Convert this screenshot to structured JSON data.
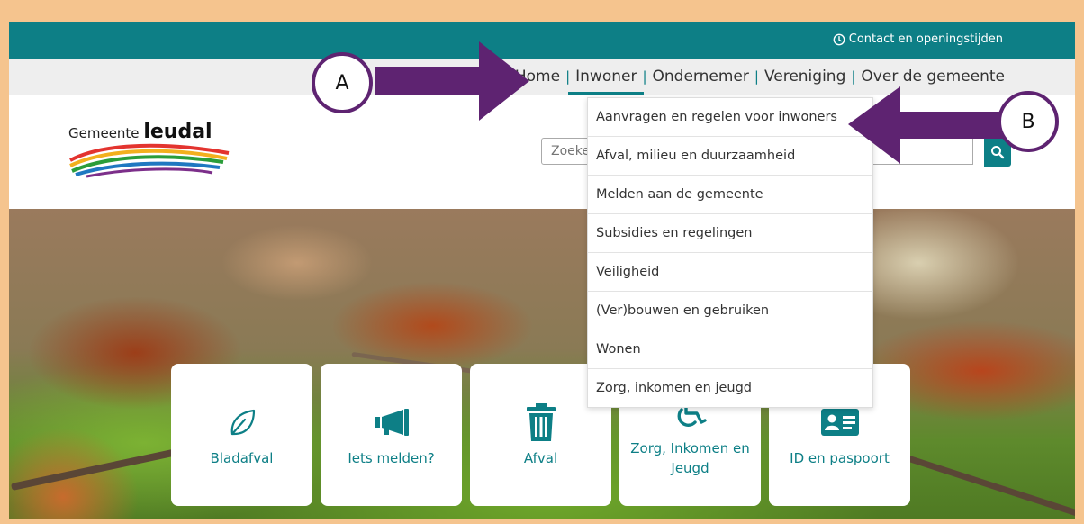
{
  "topbar": {
    "contact_label": "Contact en openingstijden"
  },
  "nav": {
    "items": [
      {
        "label": "Home"
      },
      {
        "label": "Inwoner"
      },
      {
        "label": "Ondernemer"
      },
      {
        "label": "Vereniging"
      },
      {
        "label": "Over de gemeente"
      }
    ],
    "separator": "|",
    "active": "Inwoner"
  },
  "logo": {
    "prefix": "Gemeente",
    "name": "leudal"
  },
  "search": {
    "placeholder": "Zoeken"
  },
  "dropdown": {
    "items": [
      "Aanvragen en regelen voor inwoners",
      "Afval, milieu en duurzaamheid",
      "Melden aan de gemeente",
      "Subsidies en regelingen",
      "Veiligheid",
      "(Ver)bouwen en gebruiken",
      "Wonen",
      "Zorg, inkomen en jeugd"
    ]
  },
  "cards": [
    {
      "label": "Bladafval",
      "icon": "leaf-icon"
    },
    {
      "label": "Iets melden?",
      "icon": "megaphone-icon"
    },
    {
      "label": "Afval",
      "icon": "trash-icon"
    },
    {
      "label": "Zorg, Inkomen en Jeugd",
      "icon": "wheelchair-icon"
    },
    {
      "label": "ID en paspoort",
      "icon": "id-card-icon"
    }
  ],
  "annotations": {
    "a": "A",
    "b": "B"
  },
  "colors": {
    "teal": "#0d7f86",
    "frame": "#f5c48e",
    "annotation": "#5e2371"
  }
}
